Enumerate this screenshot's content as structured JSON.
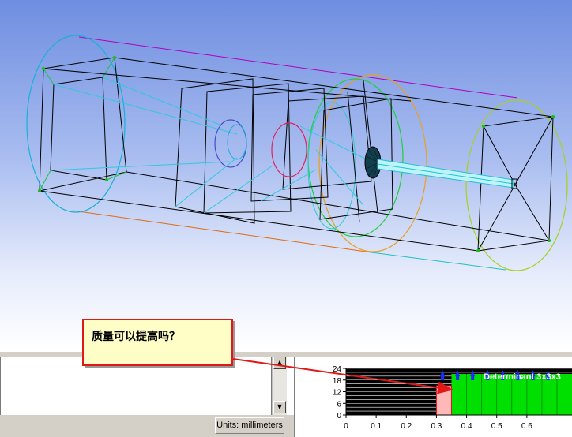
{
  "viewport": {
    "description_icon": "mesh-wireframe-geometry"
  },
  "message_panel": {
    "text": ""
  },
  "units_button": {
    "label": "Units: millimeters"
  },
  "histogram": {
    "legend": "Determinant 3x3x3",
    "y_ticks": [
      "24",
      "18",
      "12",
      "6",
      "0"
    ],
    "x_ticks": [
      "0",
      "0.1",
      "0.2",
      "0.3",
      "0.4",
      "0.5",
      "0.6"
    ],
    "colors": {
      "good": "#00e000",
      "selected": "#ffb8b8",
      "marker": "#1a2cff",
      "background": "#000000"
    }
  },
  "callout": {
    "text": "质量可以提高吗？"
  },
  "colors": {
    "callout_border": "#e01818",
    "callout_fill": "#fffec6",
    "arrow": "#e01818"
  }
}
